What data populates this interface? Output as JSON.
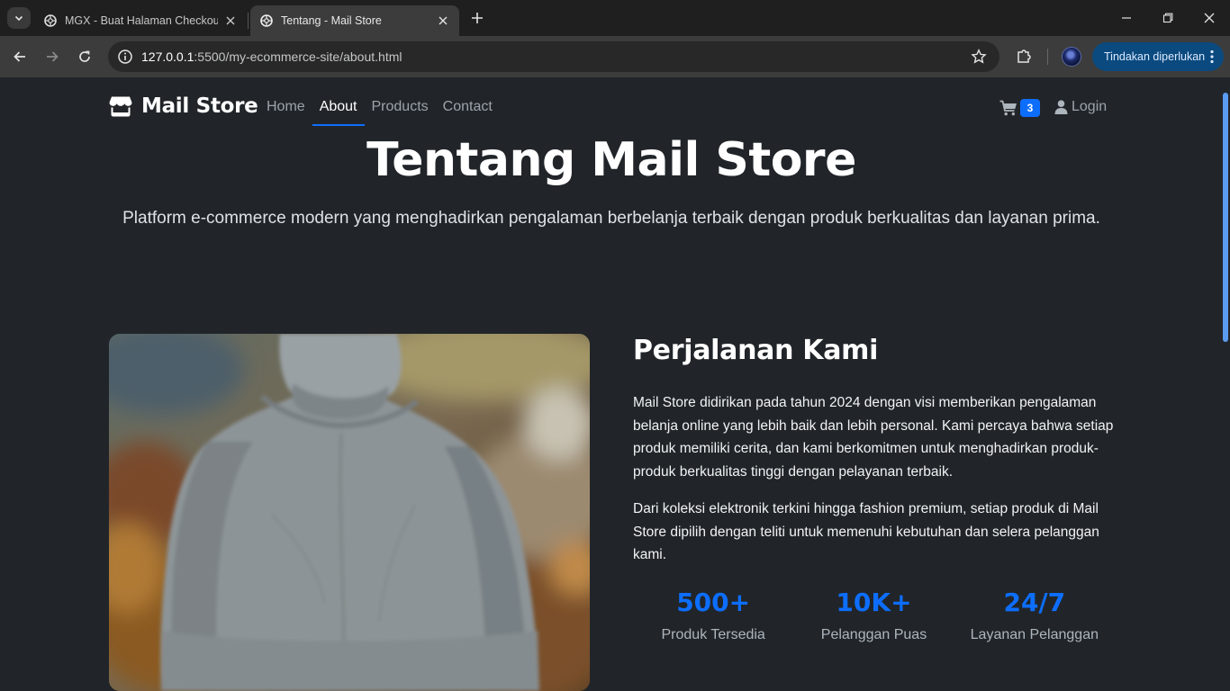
{
  "browser": {
    "tabs": [
      {
        "title": "MGX - Buat Halaman Checkout",
        "active": false
      },
      {
        "title": "Tentang - Mail Store",
        "active": true
      }
    ],
    "url_host": "127.0.0.1",
    "url_rest": ":5500/my-ecommerce-site/about.html",
    "action_label": "Tindakan diperlukan"
  },
  "navbar": {
    "brand": "Mail Store",
    "links": [
      {
        "label": "Home",
        "active": false
      },
      {
        "label": "About",
        "active": true
      },
      {
        "label": "Products",
        "active": false
      },
      {
        "label": "Contact",
        "active": false
      }
    ],
    "cart_count": "3",
    "login_label": "Login"
  },
  "hero": {
    "title": "Tentang Mail Store",
    "subtitle": "Platform e-commerce modern yang menghadirkan pengalaman berbelanja terbaik dengan produk berkualitas dan layanan prima."
  },
  "about": {
    "heading": "Perjalanan Kami",
    "paragraphs": [
      "Mail Store didirikan pada tahun 2024 dengan visi memberikan pengalaman belanja online yang lebih baik dan lebih personal. Kami percaya bahwa setiap produk memiliki cerita, dan kami berkomitmen untuk menghadirkan produk-produk berkualitas tinggi dengan pelayanan terbaik.",
      "Dari koleksi elektronik terkini hingga fashion premium, setiap produk di Mail Store dipilih dengan teliti untuk memenuhi kebutuhan dan selera pelanggan kami."
    ],
    "stats": [
      {
        "value": "500+",
        "label": "Produk Tersedia"
      },
      {
        "value": "10K+",
        "label": "Pelanggan Puas"
      },
      {
        "value": "24/7",
        "label": "Layanan Pelanggan"
      }
    ]
  },
  "colors": {
    "accent": "#0d6efd",
    "page_bg": "#212529"
  }
}
